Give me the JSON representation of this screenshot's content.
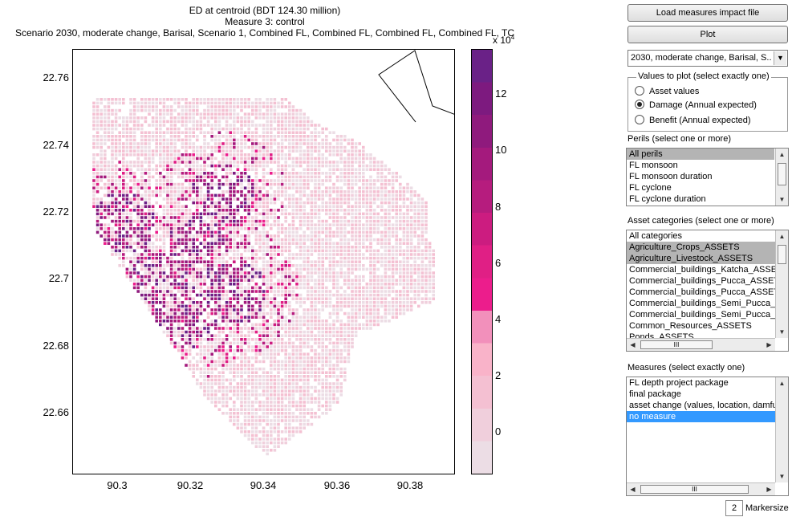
{
  "plot": {
    "title_line1": "ED at centroid (BDT 124.30 million)",
    "title_line2": "Measure 3: control",
    "title_line3": "Scenario 2030, moderate change, Barisal, Scenario 1, Combined FL, Combined FL, Combined FL, Combined FL, TC",
    "y_ticks": [
      "22.76",
      "22.74",
      "22.72",
      "22.7",
      "22.68",
      "22.66"
    ],
    "x_ticks": [
      "90.3",
      "90.32",
      "90.34",
      "90.36",
      "90.38"
    ],
    "colorbar_ticks": [
      "12",
      "10",
      "8",
      "6",
      "4",
      "2",
      "0"
    ],
    "colorbar_exponent": "x 10",
    "colorbar_exponent_power": "4",
    "colormap": [
      "#ecdde5",
      "#f0cfdc",
      "#f4c0d2",
      "#f9b3c9",
      "#f290bb",
      "#ec1d8c",
      "#e01f85",
      "#cc1c80",
      "#b61c7e",
      "#a41a7d",
      "#8f1a7d",
      "#7d1a7f",
      "#6a2187"
    ]
  },
  "controls": {
    "load_button": "Load measures impact file",
    "plot_button": "Plot",
    "scenario_dropdown": "2030, moderate change, Barisal, S..."
  },
  "values_group": {
    "title": "Values to plot (select exactly one)",
    "options": [
      "Asset values",
      "Damage (Annual expected)",
      "Benefit (Annual expected)"
    ],
    "selected": "Damage (Annual expected)"
  },
  "perils": {
    "label": "Perils (select one or more)",
    "items": [
      "All perils",
      "FL monsoon",
      "FL monsoon duration",
      "FL cyclone",
      "FL cyclone duration"
    ]
  },
  "assets": {
    "label": "Asset categories  (select one or more)",
    "items": [
      "All categories",
      "Agriculture_Crops_ASSETS",
      "Agriculture_Livestock_ASSETS",
      "Commercial_buildings_Katcha_ASSETS",
      "Commercial_buildings_Pucca_ASSETS",
      "Commercial_buildings_Pucca_ASSETS",
      "Commercial_buildings_Semi_Pucca_ASSETS",
      "Commercial_buildings_Semi_Pucca_ASSETS",
      "Common_Resources_ASSETS",
      "Ponds_ASSETS"
    ],
    "hscroll_glyph": "III"
  },
  "measures": {
    "label": "Measures (select exactly one)",
    "items": [
      "FL depth project package",
      "final package",
      "asset change (values, location, damfun)",
      "no measure"
    ],
    "hscroll_glyph": "III"
  },
  "markersize": {
    "value": "2",
    "label": "Markersize"
  }
}
